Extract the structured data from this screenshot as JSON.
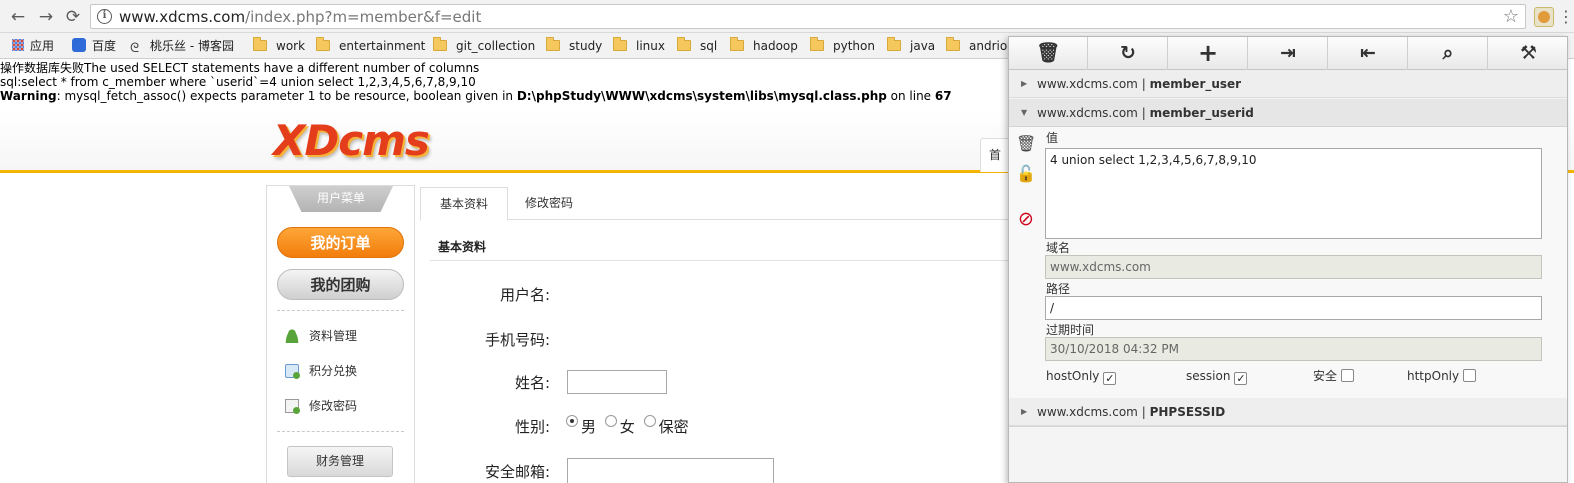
{
  "browser": {
    "url_host": "www.xdcms.com",
    "url_path": "/index.php?m=member&f=edit",
    "nav": {
      "back": "←",
      "forward": "→",
      "reload": "⟳"
    },
    "icons": {
      "info": "info-icon",
      "star": "star-icon",
      "extension": "cookie-extension-icon",
      "menu": "menu-icon"
    }
  },
  "bookmarks": [
    {
      "label": "应用",
      "icon": "apps-icon"
    },
    {
      "label": "百度",
      "icon": "baidu-icon"
    },
    {
      "label": "桃乐丝 - 博客园",
      "icon": "blog-icon"
    },
    {
      "label": "work",
      "icon": "folder-icon"
    },
    {
      "label": "entertainment",
      "icon": "folder-icon"
    },
    {
      "label": "git_collection",
      "icon": "folder-icon"
    },
    {
      "label": "study",
      "icon": "folder-icon"
    },
    {
      "label": "linux",
      "icon": "folder-icon"
    },
    {
      "label": "sql",
      "icon": "folder-icon"
    },
    {
      "label": "hadoop",
      "icon": "folder-icon"
    },
    {
      "label": "python",
      "icon": "folder-icon"
    },
    {
      "label": "java",
      "icon": "folder-icon"
    },
    {
      "label": "andrio",
      "icon": "folder-icon"
    }
  ],
  "errors": {
    "line1": "操作数据库失败The used SELECT statements have a different number of columns",
    "line2": "sql:select * from c_member where `userid`=4 union select 1,2,3,4,5,6,7,8,9,10",
    "warn_label": "Warning",
    "warn_text": ": mysql_fetch_assoc() expects parameter 1 to be resource, boolean given in ",
    "warn_file": "D:\\phpStudy\\WWW\\xdcms\\system\\libs\\mysql.class.php",
    "warn_on": " on line ",
    "warn_line": "67"
  },
  "site": {
    "logo": "XDcms",
    "nav_stub": "首"
  },
  "sidebar": {
    "title": "用户菜单",
    "orders": "我的订单",
    "groupbuy": "我的团购",
    "items": [
      "资料管理",
      "积分兑换",
      "修改密码"
    ],
    "finance": "财务管理"
  },
  "main": {
    "tabs": [
      "基本资料",
      "修改密码"
    ],
    "section_title": "基本资料",
    "fields": {
      "username": "用户名:",
      "phone": "手机号码:",
      "name": "姓名:",
      "gender": "性别:",
      "email": "安全邮箱:"
    },
    "gender_options": [
      "男",
      "女",
      "保密"
    ],
    "gender_selected": "男"
  },
  "cookie_editor": {
    "toolbar": [
      "delete-icon",
      "reset-icon",
      "add-icon",
      "import-icon",
      "export-icon",
      "search-icon",
      "settings-icon"
    ],
    "toolbar_glyphs": [
      "🗑",
      "↻",
      "+",
      "⇥",
      "⇤",
      "⌕",
      "⚒"
    ],
    "cookies": [
      {
        "domain": "www.xdcms.com",
        "name": "member_user",
        "expanded": false
      },
      {
        "domain": "www.xdcms.com",
        "name": "member_userid",
        "expanded": true
      },
      {
        "domain": "www.xdcms.com",
        "name": "PHPSESSID",
        "expanded": false
      }
    ],
    "separator": "|",
    "detail": {
      "value_label": "值",
      "value": "4 union select 1,2,3,4,5,6,7,8,9,10",
      "domain_label": "域名",
      "domain": "www.xdcms.com",
      "path_label": "路径",
      "path": "/",
      "expiry_label": "过期时间",
      "expiry": "30/10/2018 04:32 PM",
      "flags": [
        {
          "label": "hostOnly",
          "checked": true
        },
        {
          "label": "session",
          "checked": true
        },
        {
          "label": "安全",
          "checked": false
        },
        {
          "label": "httpOnly",
          "checked": false
        }
      ]
    }
  }
}
